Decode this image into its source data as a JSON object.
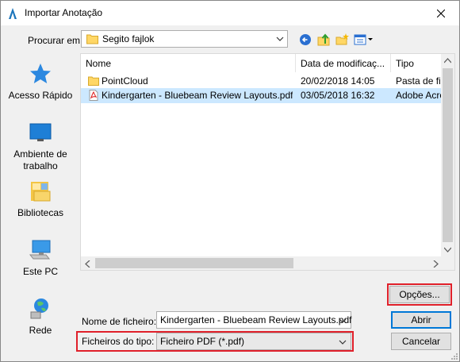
{
  "window": {
    "title": "Importar Anotação",
    "close_icon": "close-icon",
    "app_icon": "bluebeam-revu-icon"
  },
  "lookin": {
    "label": "Procurar em:",
    "value": "Segito fajlok"
  },
  "toolbar": {
    "back_icon": "back-arrow-icon",
    "up_icon": "up-folder-icon",
    "new_folder_icon": "new-folder-icon",
    "view_icon": "view-menu-icon"
  },
  "places": [
    {
      "label": "Acesso Rápido",
      "icon": "star-icon"
    },
    {
      "label": "Ambiente de trabalho",
      "icon": "desktop-icon"
    },
    {
      "label": "Bibliotecas",
      "icon": "libraries-icon"
    },
    {
      "label": "Este PC",
      "icon": "computer-icon"
    },
    {
      "label": "Rede",
      "icon": "network-icon"
    }
  ],
  "files": {
    "columns": [
      "Nome",
      "Data de modificaç...",
      "Tipo"
    ],
    "rows": [
      {
        "name": "PointCloud",
        "date": "20/02/2018 14:05",
        "type": "Pasta de fiche",
        "icon": "folder-icon",
        "selected": false
      },
      {
        "name": "Kindergarten - Bluebeam Review Layouts.pdf",
        "date": "03/05/2018 16:32",
        "type": "Adobe Acrob",
        "icon": "pdf-icon",
        "selected": true
      }
    ]
  },
  "buttons": {
    "options": "Opções...",
    "open": "Abrir",
    "cancel": "Cancelar"
  },
  "filename": {
    "label": "Nome de ficheiro:",
    "value": "Kindergarten - Bluebeam Review Layouts.pdf"
  },
  "filetype": {
    "label": "Ficheiros do tipo:",
    "value": "Ficheiro PDF (*.pdf)"
  },
  "colors": {
    "selection": "#cce8ff",
    "highlight_box": "#e0202a",
    "default_button_border": "#0078d7"
  }
}
